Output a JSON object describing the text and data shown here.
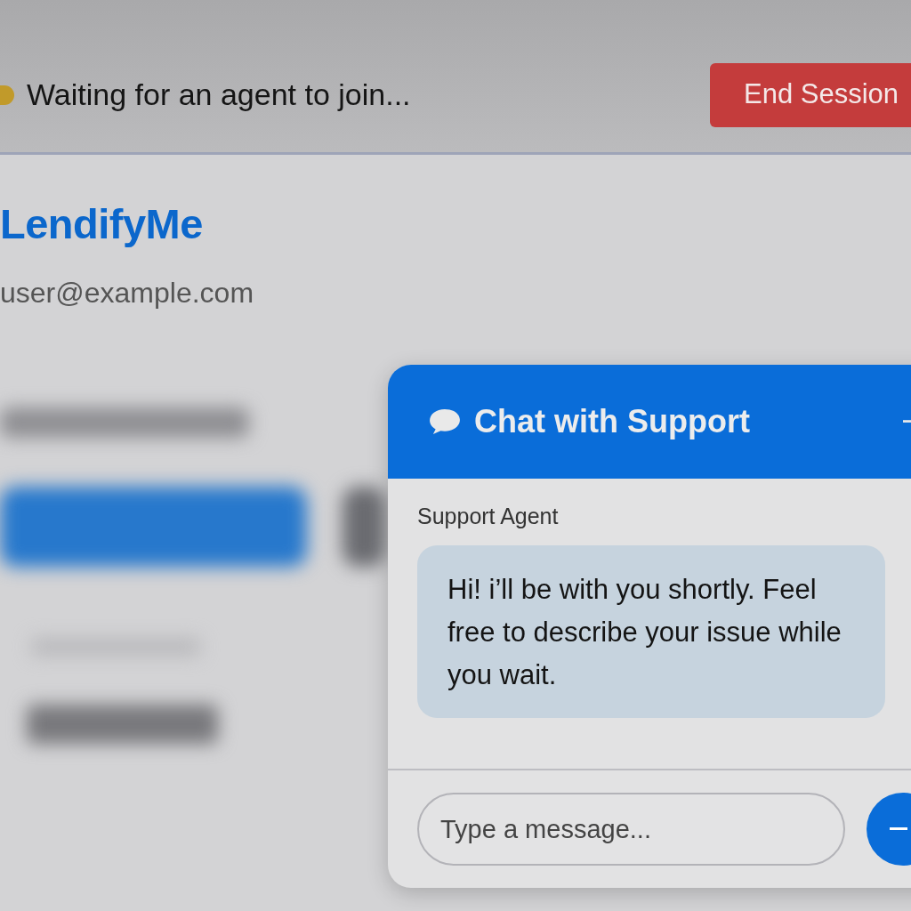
{
  "status_bar": {
    "text": "Waiting for an agent to join...",
    "button": "End Session"
  },
  "brand": {
    "name": "LendifyMe",
    "email": "user@example.com"
  },
  "chat": {
    "title": "Chat with Support",
    "messages": [
      {
        "sender": "Support Agent",
        "text": "Hi! i’ll be with you shortly. Feel free to describe your issue while you wait."
      }
    ],
    "input": {
      "placeholder": "Type a message..."
    }
  }
}
